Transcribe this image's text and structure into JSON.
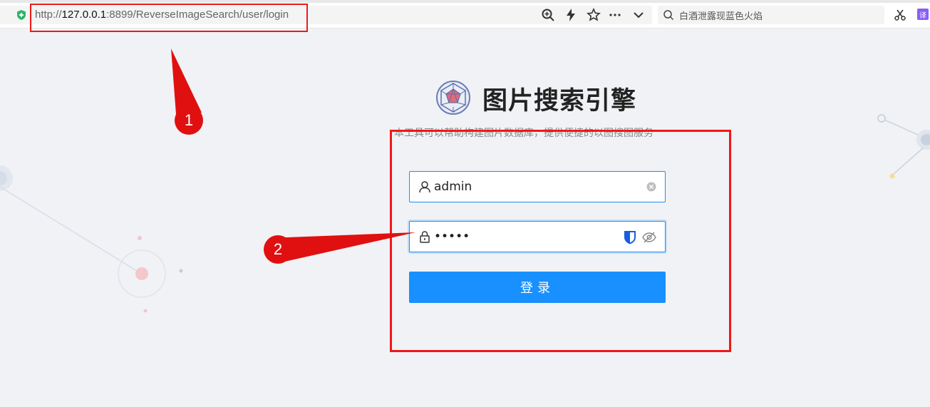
{
  "browser": {
    "url_prefix": "http://",
    "url_host": "127.0.0.1",
    "url_rest": ":8899/ReverseImageSearch/user/login",
    "search_text": "白酒泄露现蓝色火焰",
    "translate_label": "译"
  },
  "app": {
    "title": "图片搜索引擎",
    "description": "本工具可以帮助构建图片数据库，提供便捷的以图搜图服务"
  },
  "login": {
    "username_value": "admin",
    "password_value": "•••••",
    "submit_label": "登录"
  },
  "annotations": {
    "marker_1": "1",
    "marker_2": "2"
  },
  "colors": {
    "accent": "#1890ff",
    "annotation": "#e01010",
    "background": "#f0f2f5"
  }
}
